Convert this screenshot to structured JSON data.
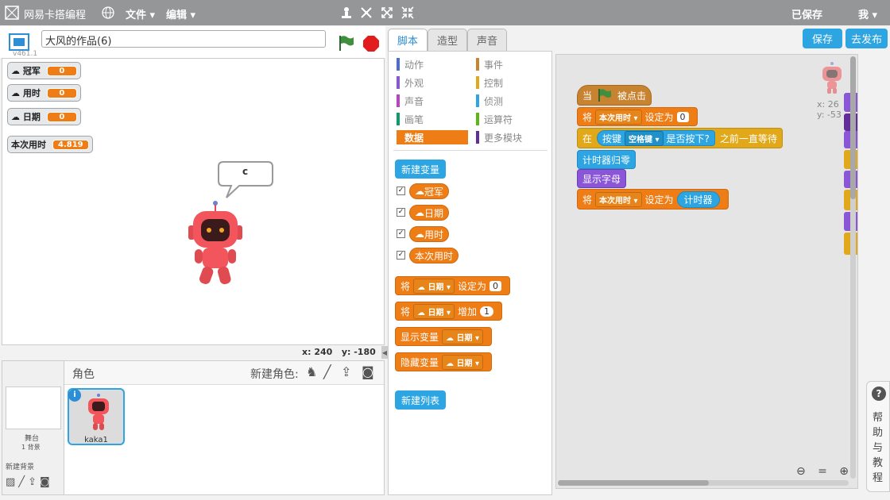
{
  "app": {
    "title": "网易卡搭编程",
    "file_menu": "文件",
    "edit_menu": "编辑",
    "saved_status": "已保存",
    "user_menu": "我"
  },
  "stage": {
    "project_name": "大风的作品(6)",
    "version": "v461.1",
    "monitors": [
      {
        "label": "冠军",
        "value": "0"
      },
      {
        "label": "用时",
        "value": "0"
      },
      {
        "label": "日期",
        "value": "0"
      },
      {
        "label": "本次用时",
        "value": "4.819"
      }
    ],
    "speech_text": "c",
    "coord_x_label": "x:",
    "coord_x": "240",
    "coord_y_label": "y:",
    "coord_y": "-180"
  },
  "sprites_panel": {
    "title": "角色",
    "new_sprite_label": "新建角色:",
    "stage_label": "舞台",
    "stage_backdrops": "1 背景",
    "new_backdrop_label": "新建背景",
    "sprite_name": "kaka1"
  },
  "tabs": [
    "脚本",
    "造型",
    "声音"
  ],
  "actions": {
    "save": "保存",
    "publish": "去发布"
  },
  "categories_left": [
    {
      "label": "动作",
      "color": "#4a6cd4"
    },
    {
      "label": "外观",
      "color": "#8a55d7"
    },
    {
      "label": "声音",
      "color": "#bb42c3"
    },
    {
      "label": "画笔",
      "color": "#0e9a6c"
    },
    {
      "label": "数据",
      "color": "#ee7d16"
    }
  ],
  "categories_right": [
    {
      "label": "事件",
      "color": "#c88330"
    },
    {
      "label": "控制",
      "color": "#e1a91a"
    },
    {
      "label": "侦测",
      "color": "#2ca5e2"
    },
    {
      "label": "运算符",
      "color": "#5cb712"
    },
    {
      "label": "更多模块",
      "color": "#632d99"
    }
  ],
  "palette": {
    "new_variable": "新建变量",
    "variables": [
      "冠军",
      "日期",
      "用时",
      "本次用时"
    ],
    "set_block": {
      "prefix": "将",
      "var": "日期",
      "mid": "设定为",
      "value": "0"
    },
    "change_block": {
      "prefix": "将",
      "var": "日期",
      "mid": "增加",
      "value": "1"
    },
    "show_var": {
      "label": "显示变量",
      "var": "日期"
    },
    "hide_var": {
      "label": "隐藏变量",
      "var": "日期"
    },
    "new_list": "新建列表"
  },
  "script": {
    "hat": {
      "prefix": "当",
      "suffix": "被点击"
    },
    "set1": {
      "prefix": "将",
      "var": "本次用时",
      "mid": "设定为",
      "value": "0"
    },
    "wait": {
      "prefix": "在",
      "key_label": "按键",
      "key": "空格键",
      "pressed": "是否按下?",
      "suffix": "之前一直等待"
    },
    "reset_timer": "计时器归零",
    "show": "显示字母",
    "set2": {
      "prefix": "将",
      "var": "本次用时",
      "mid": "设定为",
      "reporter": "计时器"
    },
    "sprite_x_label": "x:",
    "sprite_x": "26",
    "sprite_y_label": "y:",
    "sprite_y": "-53"
  },
  "help": {
    "label": "帮助与教程"
  }
}
